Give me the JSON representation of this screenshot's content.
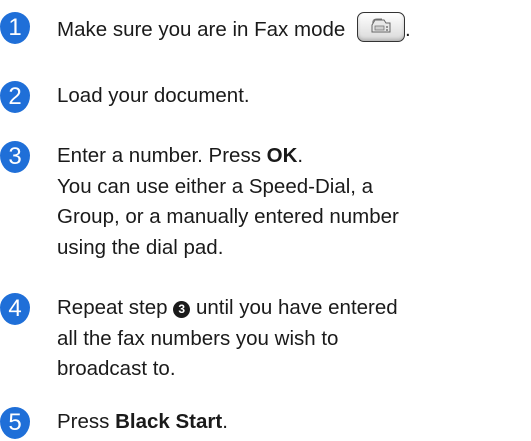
{
  "steps": [
    {
      "number": "1",
      "text": "Make sure you are in Fax mode",
      "trailing": "."
    },
    {
      "number": "2",
      "text": "Load your document."
    },
    {
      "number": "3",
      "text_before": "Enter a number. Press ",
      "bold": "OK",
      "text_after": ".",
      "lines": [
        "You can use either a Speed-Dial, a",
        "Group, or a manually entered number",
        "using the dial pad."
      ]
    },
    {
      "number": "4",
      "text_before": "Repeat step ",
      "ref": "3",
      "text_after": " until you have entered",
      "lines": [
        "all the fax numbers you wish to",
        "broadcast to."
      ]
    },
    {
      "number": "5",
      "text_before": "Press ",
      "bold": "Black Start",
      "text_after": "."
    }
  ],
  "icons": {
    "fax_mode": "fax-machine-icon"
  },
  "colors": {
    "step_badge": "#1f6fd8"
  }
}
